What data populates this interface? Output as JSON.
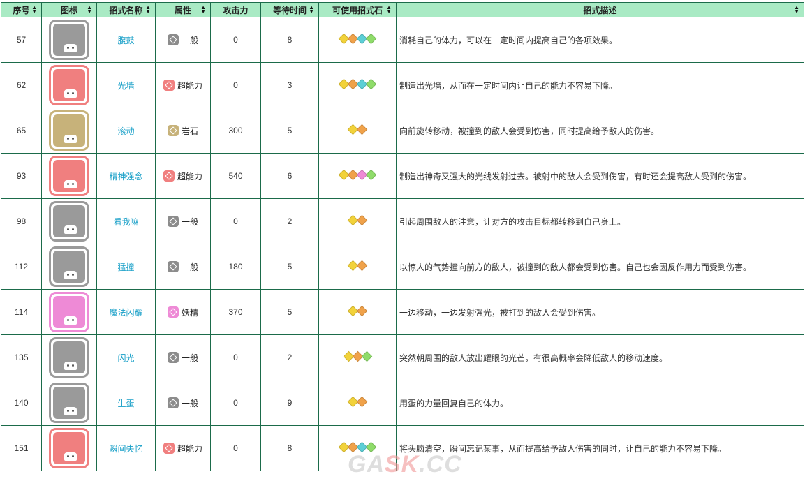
{
  "columns": [
    "序号",
    "图标",
    "招式名称",
    "属性",
    "攻击力",
    "等待时间",
    "可使用招式石",
    "招式描述"
  ],
  "colors": {
    "header_bg": "#a9eac4",
    "border": "#1b6b4a",
    "name_link": "#1aa0c8",
    "type_normal": "#8c8c8c",
    "type_psychic": "#f07f7f",
    "type_rock": "#c7b27a",
    "type_fairy": "#ee8ad6",
    "stone_yellow": "#f2d23a",
    "stone_orange": "#f0a24a",
    "stone_cyan": "#5ccfd6",
    "stone_green": "#8fdc6a",
    "stone_pink": "#ee8ad6"
  },
  "rows": [
    {
      "id": "57",
      "name": "腹鼓",
      "type": "一般",
      "type_color": "#8c8c8c",
      "attack": "0",
      "wait": "8",
      "stones": [
        "#f2d23a",
        "#f0a24a",
        "#5ccfd6",
        "#8fdc6a"
      ],
      "desc": "消耗自己的体力，可以在一定时间内提高自己的各项效果。",
      "icon_bg": "#9a9a9a",
      "icon_glyph": "grid-icon"
    },
    {
      "id": "62",
      "name": "光墙",
      "type": "超能力",
      "type_color": "#f07f7f",
      "attack": "0",
      "wait": "3",
      "stones": [
        "#f2d23a",
        "#f0a24a",
        "#5ccfd6",
        "#8fdc6a"
      ],
      "desc": "制造出光墙，从而在一定时间内让自己的能力不容易下降。",
      "icon_bg": "#f07f7f",
      "icon_glyph": "wall-icon"
    },
    {
      "id": "65",
      "name": "滚动",
      "type": "岩石",
      "type_color": "#c7b27a",
      "attack": "300",
      "wait": "5",
      "stones": [
        "#f2d23a",
        "#f0a24a"
      ],
      "desc": "向前旋转移动，被撞到的敌人会受到伤害，同时提高给予敌人的伤害。",
      "icon_bg": "#c7b27a",
      "icon_glyph": "roll-icon"
    },
    {
      "id": "93",
      "name": "精神强念",
      "type": "超能力",
      "type_color": "#f07f7f",
      "attack": "540",
      "wait": "6",
      "stones": [
        "#f2d23a",
        "#f0a24a",
        "#ee8ad6",
        "#8fdc6a"
      ],
      "desc": "制造出神奇又强大的光线发射过去。被射中的敌人会受到伤害，有时还会提高敌人受到的伤害。",
      "icon_bg": "#f07f7f",
      "icon_glyph": "beam-icon"
    },
    {
      "id": "98",
      "name": "看我嘛",
      "type": "一般",
      "type_color": "#8c8c8c",
      "attack": "0",
      "wait": "2",
      "stones": [
        "#f2d23a",
        "#f0a24a"
      ],
      "desc": "引起周围敌人的注意，让对方的攻击目标都转移到自己身上。",
      "icon_bg": "#9a9a9a",
      "icon_glyph": "hand-icon"
    },
    {
      "id": "112",
      "name": "猛撞",
      "type": "一般",
      "type_color": "#8c8c8c",
      "attack": "180",
      "wait": "5",
      "stones": [
        "#f2d23a",
        "#f0a24a"
      ],
      "desc": "以惊人的气势撞向前方的敌人，被撞到的敌人都会受到伤害。自己也会因反作用力而受到伤害。",
      "icon_bg": "#9a9a9a",
      "icon_glyph": "tackle-icon"
    },
    {
      "id": "114",
      "name": "魔法闪耀",
      "type": "妖精",
      "type_color": "#ee8ad6",
      "attack": "370",
      "wait": "5",
      "stones": [
        "#f2d23a",
        "#f0a24a"
      ],
      "desc": "一边移动，一边发射强光，被打到的敌人会受到伤害。",
      "icon_bg": "#ee8ad6",
      "icon_glyph": "shine-icon"
    },
    {
      "id": "135",
      "name": "闪光",
      "type": "一般",
      "type_color": "#8c8c8c",
      "attack": "0",
      "wait": "2",
      "stones": [
        "#f2d23a",
        "#f0a24a",
        "#8fdc6a"
      ],
      "desc": "突然朝周围的敌人放出耀眼的光芒，有很高概率会降低敌人的移动速度。",
      "icon_bg": "#9a9a9a",
      "icon_glyph": "flash-icon"
    },
    {
      "id": "140",
      "name": "生蛋",
      "type": "一般",
      "type_color": "#8c8c8c",
      "attack": "0",
      "wait": "9",
      "stones": [
        "#f2d23a",
        "#f0a24a"
      ],
      "desc": "用蛋的力量回复自己的体力。",
      "icon_bg": "#9a9a9a",
      "icon_glyph": "egg-icon"
    },
    {
      "id": "151",
      "name": "瞬间失忆",
      "type": "超能力",
      "type_color": "#f07f7f",
      "attack": "0",
      "wait": "8",
      "stones": [
        "#f2d23a",
        "#f0a24a",
        "#5ccfd6",
        "#8fdc6a"
      ],
      "desc": "将头脑清空，瞬间忘记某事，从而提高给予敌人伤害的同时，让自己的能力不容易下降。",
      "icon_bg": "#f07f7f",
      "icon_glyph": "amnesia-icon"
    }
  ],
  "watermark": {
    "part1": "GA",
    "part2": "SK",
    "part3": ".CC"
  }
}
